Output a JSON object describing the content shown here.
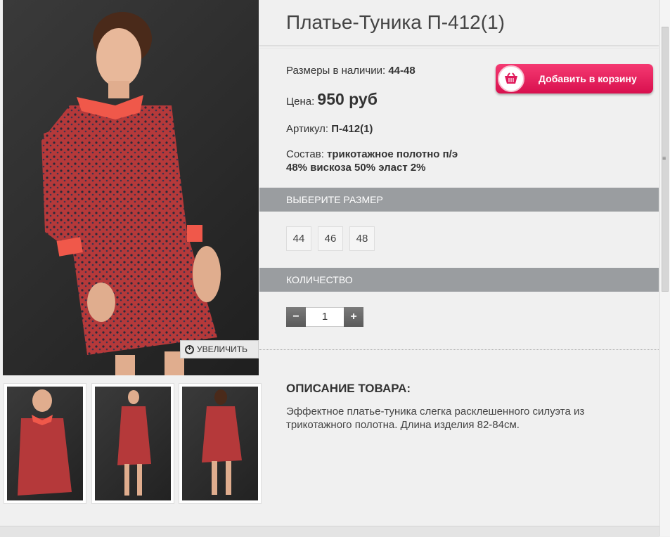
{
  "gallery": {
    "main_alt": "model-photo-front",
    "zoom_label": "УВЕЛИЧИТЬ",
    "thumbnails": [
      "thumb-front",
      "thumb-full",
      "thumb-back"
    ]
  },
  "product": {
    "title": "Платье-Туника П-412(1)",
    "sizes_label": "Размеры в наличии:",
    "sizes_value": "44-48",
    "price_label": "Цена:",
    "price_value": "950 руб",
    "sku_label": "Артикул:",
    "sku_value": "П-412(1)",
    "composition_label": "Состав:",
    "composition_line1": "трикотажное полотно п/э",
    "composition_line2": "48% вискоза 50% эласт 2%",
    "add_to_cart": "Добавить в корзину"
  },
  "size_select": {
    "heading": "ВЫБЕРИТЕ РАЗМЕР",
    "options": [
      "44",
      "46",
      "48"
    ]
  },
  "quantity": {
    "heading": "КОЛИЧЕСТВО",
    "minus": "−",
    "value": "1",
    "plus": "+"
  },
  "description": {
    "heading": "ОПИСАНИЕ ТОВАРА:",
    "text": "Эффектное платье-туника слегка расклешенного силуэта из трикотажного полотна. Длина изделия 82-84см."
  },
  "colors": {
    "accent": "#e0185a",
    "bar": "#9a9da0",
    "dress": "#b5393a",
    "collar": "#f0584a"
  }
}
